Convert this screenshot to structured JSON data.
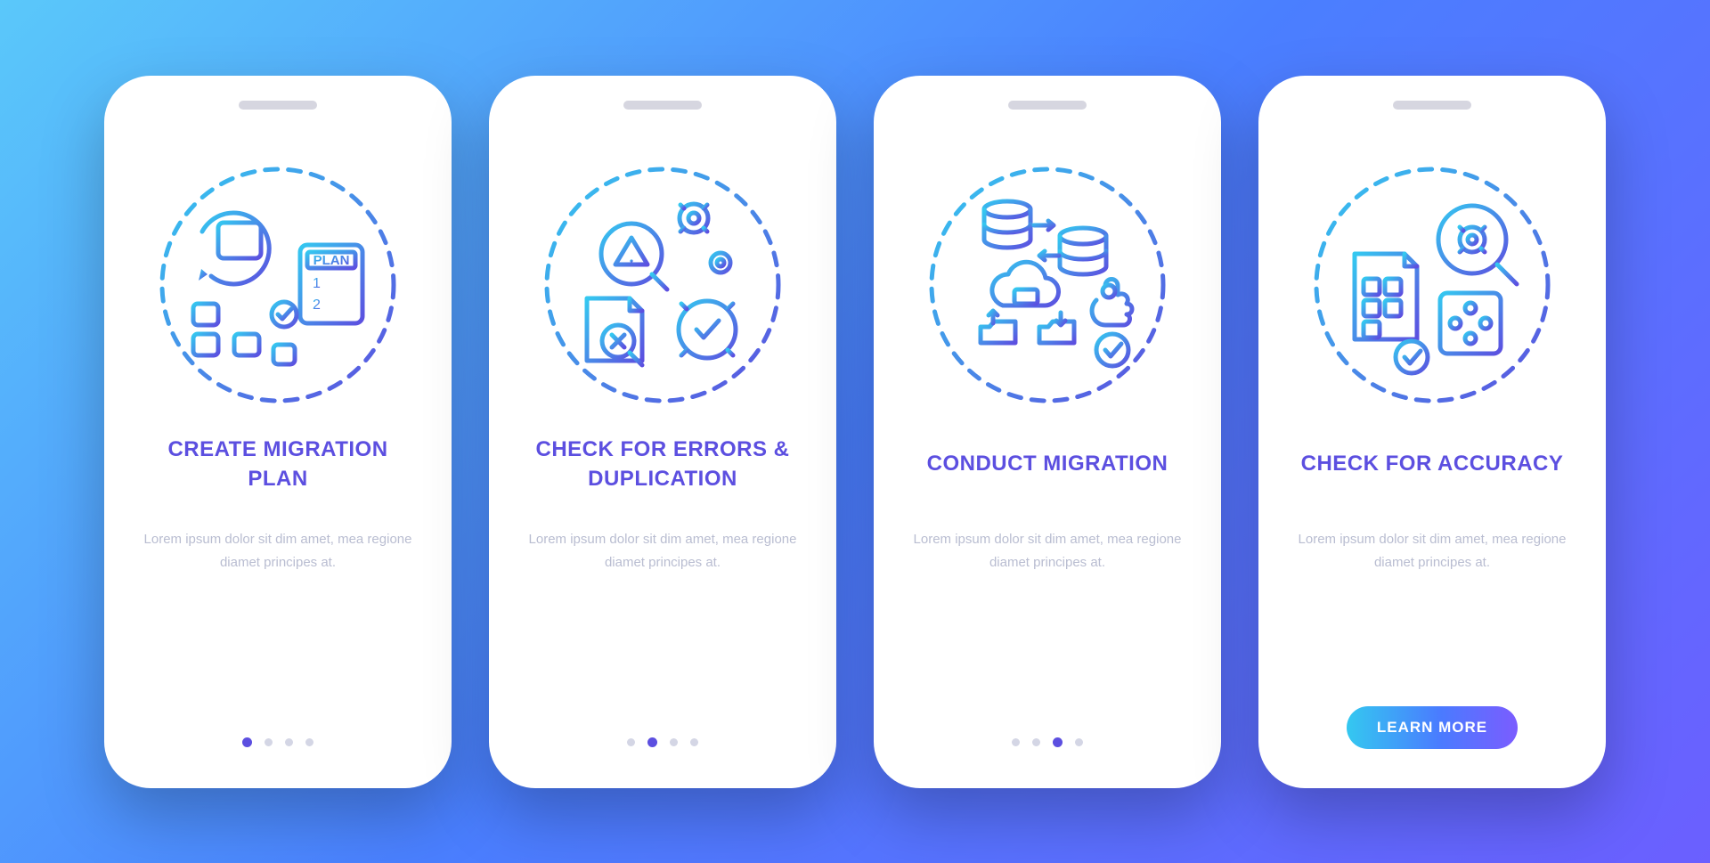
{
  "colors": {
    "title": "#5C4FE0",
    "body": "#B9BDD1",
    "dot": "#D4D6E5",
    "dot_active": "#5C4FE0"
  },
  "screens": [
    {
      "icon": "plan-icon",
      "title": "CREATE MIGRATION PLAN",
      "body": "Lorem ipsum dolor sit dim amet, mea regione diamet principes at.",
      "active_index": 0,
      "has_button": false
    },
    {
      "icon": "errors-icon",
      "title": "CHECK FOR ERRORS & DUPLICATION",
      "body": "Lorem ipsum dolor sit dim amet, mea regione diamet principes at.",
      "active_index": 1,
      "has_button": false
    },
    {
      "icon": "conduct-icon",
      "title": "CONDUCT MIGRATION",
      "body": "Lorem ipsum dolor sit dim amet, mea regione diamet principes at.",
      "active_index": 2,
      "has_button": false
    },
    {
      "icon": "accuracy-icon",
      "title": "CHECK FOR ACCURACY",
      "body": "Lorem ipsum dolor sit dim amet, mea regione diamet principes at.",
      "active_index": 3,
      "has_button": true,
      "button_label": "LEARN MORE"
    }
  ],
  "dot_count": 4
}
